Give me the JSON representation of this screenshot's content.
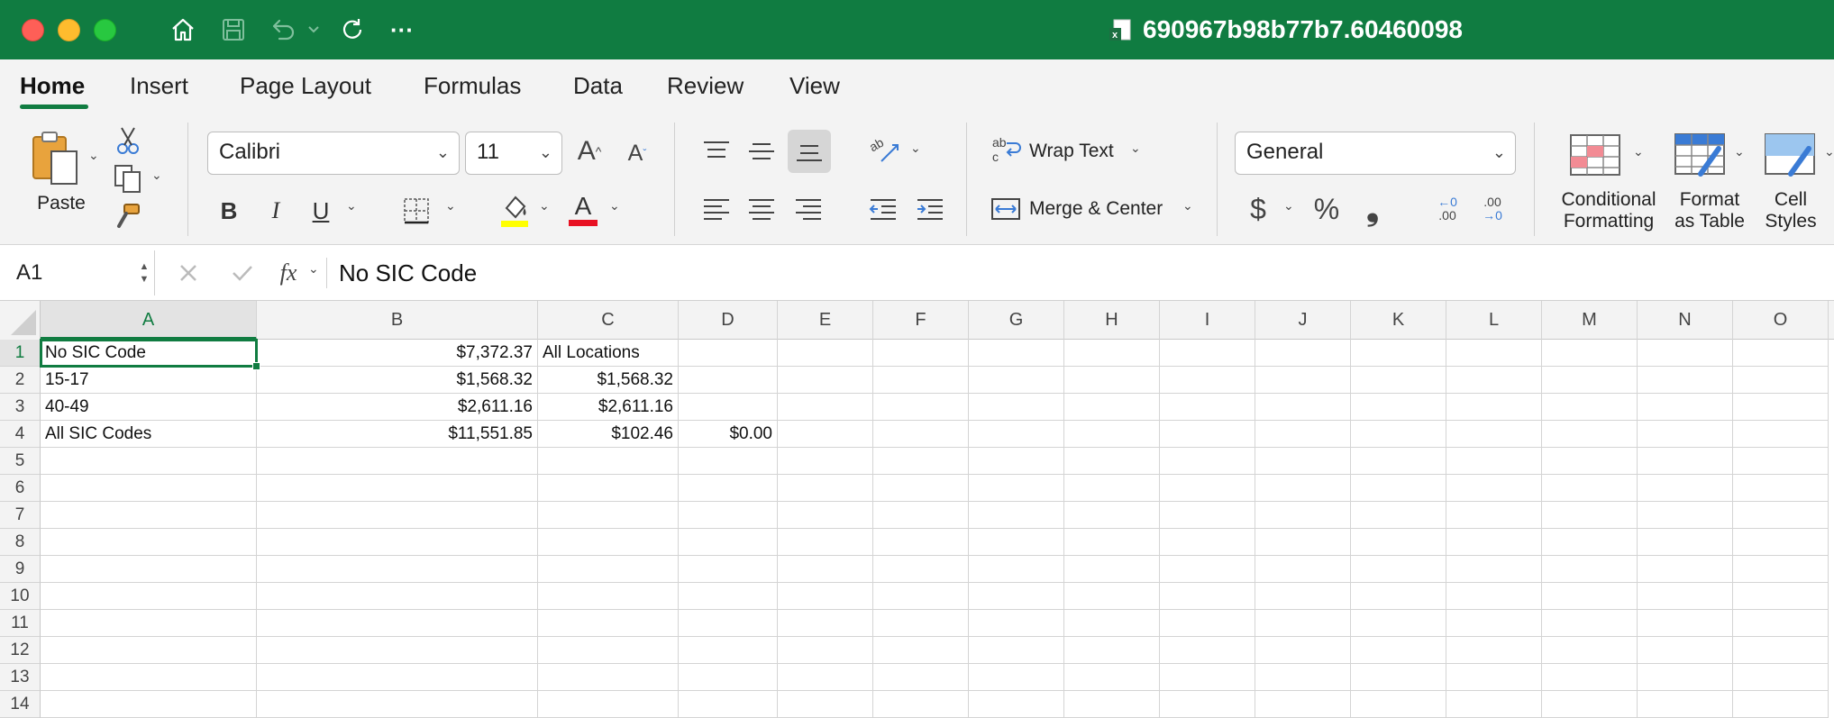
{
  "window": {
    "title": "690967b98b77b7.60460098",
    "toolbar_more": "···"
  },
  "ribbon_tabs": [
    "Home",
    "Insert",
    "Page Layout",
    "Formulas",
    "Data",
    "Review",
    "View"
  ],
  "ribbon": {
    "paste_label": "Paste",
    "font_name": "Calibri",
    "font_size": "11",
    "bold": "B",
    "italic": "I",
    "underline": "U",
    "increase_font": "A",
    "decrease_font": "A",
    "font_color_glyph": "A",
    "wrap_text": "Wrap Text",
    "merge_center": "Merge & Center",
    "number_format": "General",
    "currency": "$",
    "percent": "%",
    "comma": "❟",
    "inc_decimal": ".00",
    "dec_decimal": ".00",
    "conditional_formatting": [
      "Conditional",
      "Formatting"
    ],
    "format_as_table": [
      "Format",
      "as Table"
    ],
    "cell_styles": [
      "Cell",
      "Styles"
    ]
  },
  "formula_bar": {
    "name_box": "A1",
    "fx": "fx",
    "formula": "No SIC Code"
  },
  "sheet": {
    "columns": [
      "A",
      "B",
      "C",
      "D",
      "E",
      "F",
      "G",
      "H",
      "I",
      "J",
      "K",
      "L",
      "M",
      "N",
      "O"
    ],
    "rows": [
      "1",
      "2",
      "3",
      "4",
      "5",
      "6",
      "7",
      "8",
      "9",
      "10",
      "11",
      "12",
      "13",
      "14"
    ],
    "cells": {
      "A1": "No SIC Code",
      "B1": "$7,372.37",
      "C1": "All Locations",
      "A2": "15-17",
      "B2": "$1,568.32",
      "C2": "$1,568.32",
      "A3": "40-49",
      "B3": "$2,611.16",
      "C3": "$2,611.16",
      "A4": "All SIC Codes",
      "B4": "$11,551.85",
      "C4": "$102.46",
      "D4": "$0.00"
    },
    "numeric_cells": [
      "B1",
      "B2",
      "C2",
      "B3",
      "C3",
      "B4",
      "C4",
      "D4"
    ],
    "selected_cell": "A1"
  },
  "colors": {
    "accent": "#107c41",
    "fill_color_bar": "#ffff00",
    "font_color_bar": "#e81123"
  }
}
